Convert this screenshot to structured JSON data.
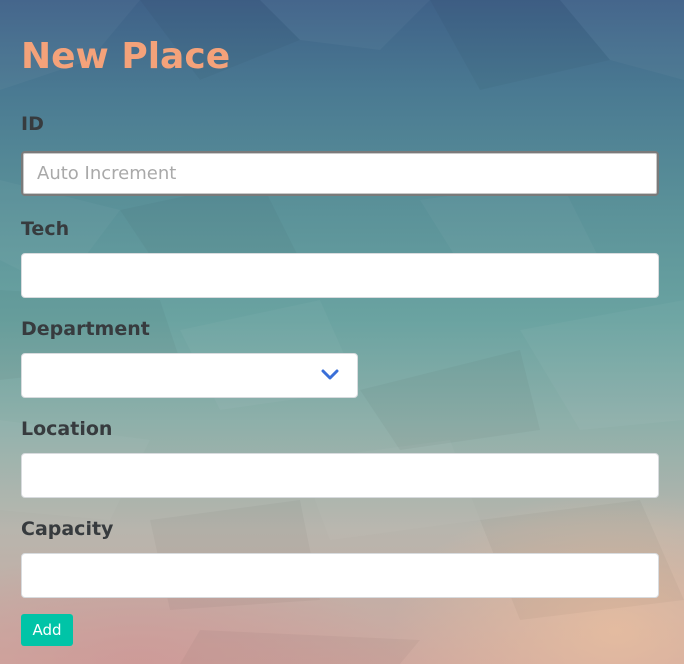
{
  "page": {
    "title": "New Place"
  },
  "form": {
    "id": {
      "label": "ID",
      "placeholder": "Auto Increment",
      "value": ""
    },
    "tech": {
      "label": "Tech",
      "placeholder": "",
      "value": ""
    },
    "department": {
      "label": "Department",
      "selected": "",
      "chevron_icon": "chevron-down-icon"
    },
    "location": {
      "label": "Location",
      "placeholder": "",
      "value": ""
    },
    "capacity": {
      "label": "Capacity",
      "placeholder": "",
      "value": ""
    },
    "submit_label": "Add"
  },
  "colors": {
    "title": "#f4a27a",
    "label": "#373b3e",
    "button_bg": "#00c4a7",
    "button_text": "#ffffff",
    "chevron": "#3a6fd8"
  }
}
